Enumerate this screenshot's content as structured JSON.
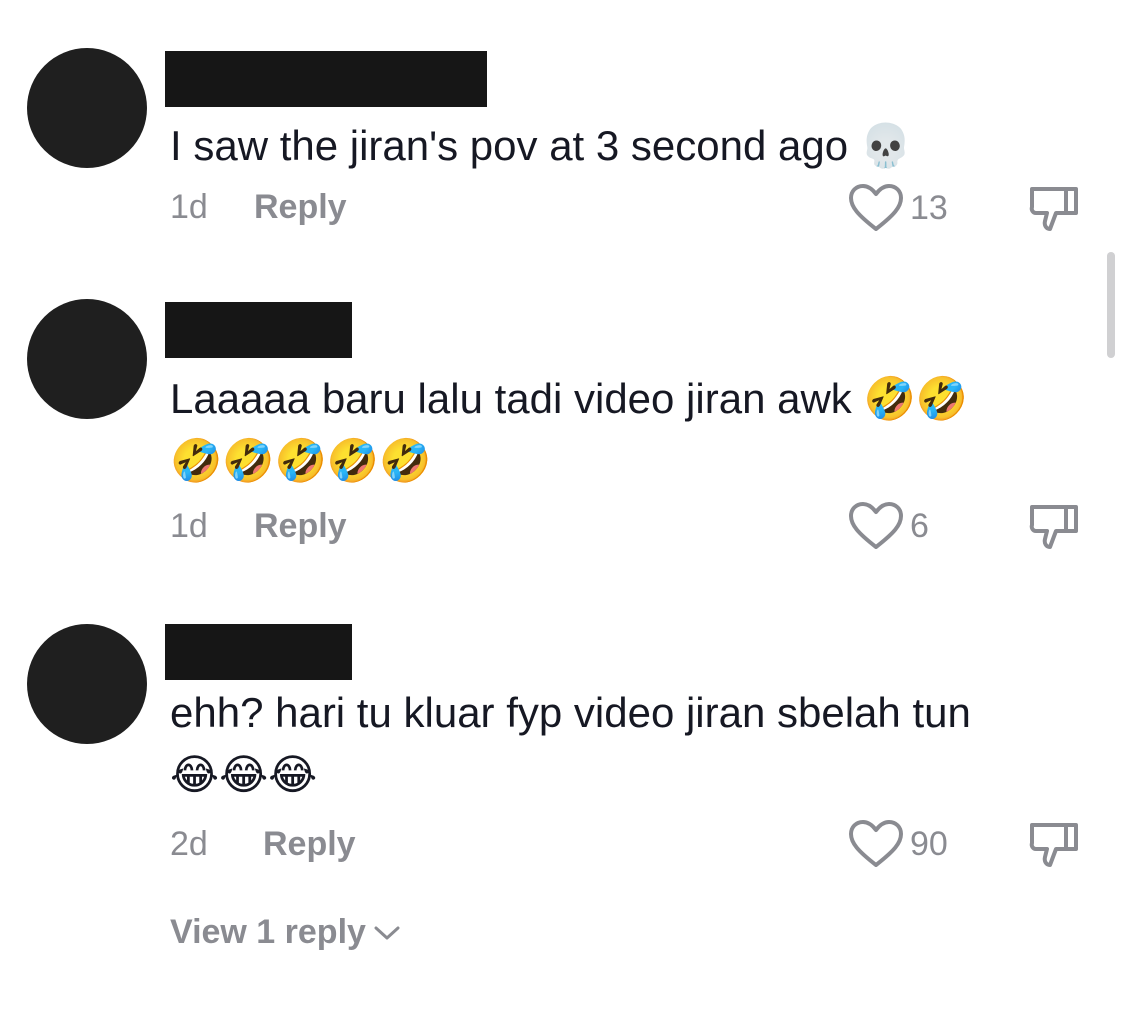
{
  "comments": [
    {
      "text": "I saw the jiran's pov at 3 second ago 💀",
      "age": "1d",
      "reply_label": "Reply",
      "likes": "13"
    },
    {
      "text": "Laaaaa baru lalu tadi video jiran awk 🤣🤣\n🤣🤣🤣🤣🤣",
      "age": "1d",
      "reply_label": "Reply",
      "likes": "6"
    },
    {
      "text": "ehh? hari tu kluar fyp video jiran sbelah tun\n😂😂😂",
      "age": "2d",
      "reply_label": "Reply",
      "likes": "90"
    }
  ],
  "view_replies_label": "View 1 reply",
  "icons": {
    "like": "heart-outline-icon",
    "dislike": "thumbs-down-outline-icon",
    "expand": "chevron-down-icon"
  },
  "colors": {
    "text": "#161823",
    "secondary": "#8a8b91",
    "avatar": "#1f1f1f"
  }
}
